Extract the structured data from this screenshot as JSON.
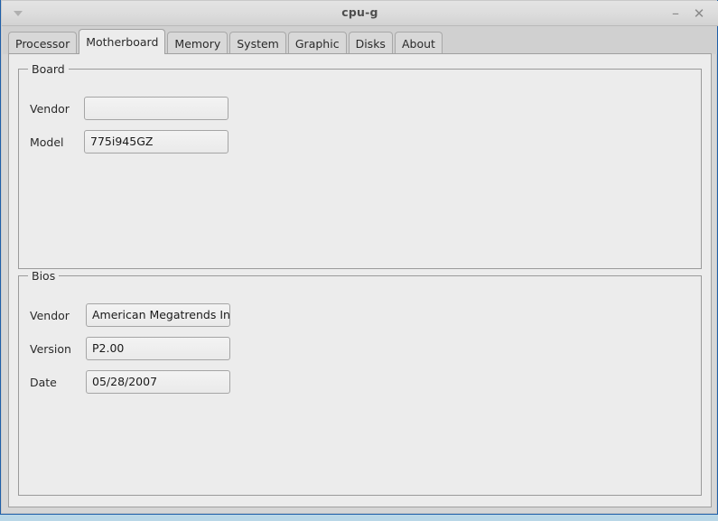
{
  "window": {
    "title": "cpu-g",
    "menu_icon": "triangle-down-icon",
    "minimize_label": "–",
    "close_label": "✕"
  },
  "tabs": [
    {
      "label": "Processor",
      "active": false
    },
    {
      "label": "Motherboard",
      "active": true
    },
    {
      "label": "Memory",
      "active": false
    },
    {
      "label": "System",
      "active": false
    },
    {
      "label": "Graphic",
      "active": false
    },
    {
      "label": "Disks",
      "active": false
    },
    {
      "label": "About",
      "active": false
    }
  ],
  "board": {
    "legend": "Board",
    "vendor_label": "Vendor",
    "vendor_value": "",
    "model_label": "Model",
    "model_value": "775i945GZ"
  },
  "bios": {
    "legend": "Bios",
    "vendor_label": "Vendor",
    "vendor_value": "American Megatrends Inc.",
    "version_label": "Version",
    "version_value": "P2.00",
    "date_label": "Date",
    "date_value": "05/28/2007"
  },
  "colors": {
    "titlebar": "#dcdcdc",
    "tabstrip": "#d0d0d0",
    "content": "#ececec",
    "frame_border": "#9a9a9a",
    "window_border": "#1f5fa8",
    "desktop": "#b9d7e7"
  }
}
